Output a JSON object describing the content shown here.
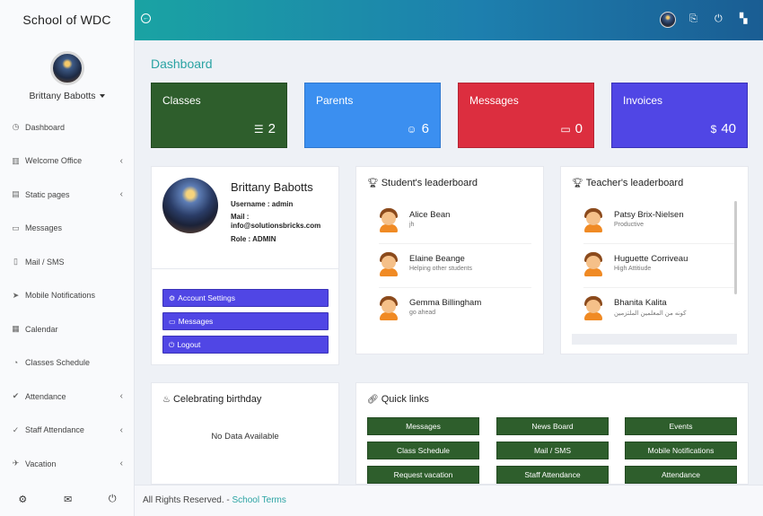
{
  "app": {
    "title": "School of WDC"
  },
  "user": {
    "name": "Brittany Babotts"
  },
  "sidebar": {
    "items": [
      {
        "label": "Dashboard",
        "icon": "dashboard-icon",
        "has_submenu": false
      },
      {
        "label": "Welcome Office",
        "icon": "book-icon",
        "has_submenu": true
      },
      {
        "label": "Static pages",
        "icon": "pages-icon",
        "has_submenu": true
      },
      {
        "label": "Messages",
        "icon": "message-icon",
        "has_submenu": false
      },
      {
        "label": "Mail / SMS",
        "icon": "mobile-icon",
        "has_submenu": false
      },
      {
        "label": "Mobile Notifications",
        "icon": "send-icon",
        "has_submenu": false
      },
      {
        "label": "Calendar",
        "icon": "calendar-icon",
        "has_submenu": false
      },
      {
        "label": "Classes Schedule",
        "icon": "clock-icon",
        "has_submenu": false
      },
      {
        "label": "Attendance",
        "icon": "check-all-icon",
        "has_submenu": true
      },
      {
        "label": "Staff Attendance",
        "icon": "check-icon",
        "has_submenu": true
      },
      {
        "label": "Vacation",
        "icon": "plane-icon",
        "has_submenu": true
      }
    ],
    "footer_icons": [
      "gear-icon",
      "mail-icon",
      "power-icon"
    ]
  },
  "topbar": {
    "icons": [
      "back-icon",
      "language-icon",
      "power-icon",
      "grid-icon"
    ]
  },
  "page": {
    "title": "Dashboard"
  },
  "stats": [
    {
      "label": "Classes",
      "value": "2",
      "icon": "list-icon",
      "color": "#2e5e2c"
    },
    {
      "label": "Parents",
      "value": "6",
      "icon": "user-icon",
      "color": "#3b8ff0"
    },
    {
      "label": "Messages",
      "value": "0",
      "icon": "message-icon",
      "color": "#dc2e3f"
    },
    {
      "label": "Invoices",
      "value": "40",
      "icon": "dollar-icon",
      "color": "#5046e5"
    }
  ],
  "profile": {
    "name": "Brittany Babotts",
    "username": "Username : admin",
    "mail_label": "Mail :",
    "mail": "info@solutionsbricks.com",
    "role": "Role : ADMIN",
    "buttons": [
      "Account Settings",
      "Messages",
      "Logout"
    ]
  },
  "students_leaderboard": {
    "title": "Student's leaderboard",
    "rows": [
      {
        "name": "Alice Bean",
        "sub": "jh"
      },
      {
        "name": "Elaine Beange",
        "sub": "Helping other students"
      },
      {
        "name": "Gemma Billingham",
        "sub": "go ahead"
      }
    ]
  },
  "teachers_leaderboard": {
    "title": "Teacher's leaderboard",
    "rows": [
      {
        "name": "Patsy Brix-Nielsen",
        "sub": "Productive"
      },
      {
        "name": "Huguette Corriveau",
        "sub": "High Attitiude"
      },
      {
        "name": "Bhanita Kalita",
        "sub": "كونه من المعلمين الملتزمين"
      }
    ]
  },
  "birthday": {
    "title": "Celebrating birthday",
    "empty": "No Data Available"
  },
  "quick_links": {
    "title": "Quick links",
    "items": [
      "Messages",
      "News Board",
      "Events",
      "Class Schedule",
      "Mail / SMS",
      "Mobile Notifications",
      "Request vacation",
      "Staff Attendance",
      "Attendance"
    ]
  },
  "footer": {
    "text": "All Rights Reserved. - ",
    "link": "School Terms"
  }
}
